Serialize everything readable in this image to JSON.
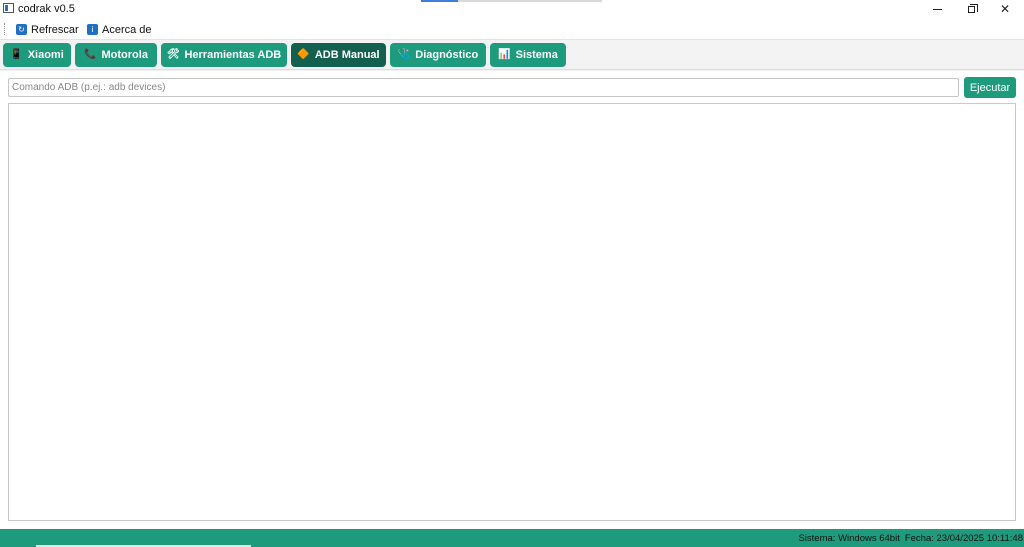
{
  "window": {
    "title": "codrak v0.5",
    "close_symbol": "✕"
  },
  "menu": {
    "refresh_label": "Refrescar",
    "refresh_icon": "refresh-icon",
    "about_label": "Acerca de",
    "about_icon": "info-icon",
    "about_icon_glyph": "i"
  },
  "tabs": [
    {
      "label": "Xiaomi",
      "icon": "📱",
      "active": false
    },
    {
      "label": "Motorola",
      "icon": "📞",
      "active": false
    },
    {
      "label": "Herramientas ADB",
      "icon": "🛠",
      "active": false
    },
    {
      "label": "ADB Manual",
      "icon": "🔶",
      "active": true
    },
    {
      "label": "Diagnóstico",
      "icon": "🩺",
      "active": false
    },
    {
      "label": "Sistema",
      "icon": "📊",
      "active": false
    }
  ],
  "command": {
    "placeholder": "Comando ADB (p.ej.: adb devices)",
    "value": "",
    "execute_label": "Ejecutar"
  },
  "output": {
    "text": ""
  },
  "status": {
    "system": "Sistema: Windows 64bit",
    "date": "Fecha: 23/04/2025 10:11:48"
  },
  "colors": {
    "accent": "#1d9b7c",
    "accent_active": "#14604e",
    "status_bar": "#1d9b7c"
  }
}
